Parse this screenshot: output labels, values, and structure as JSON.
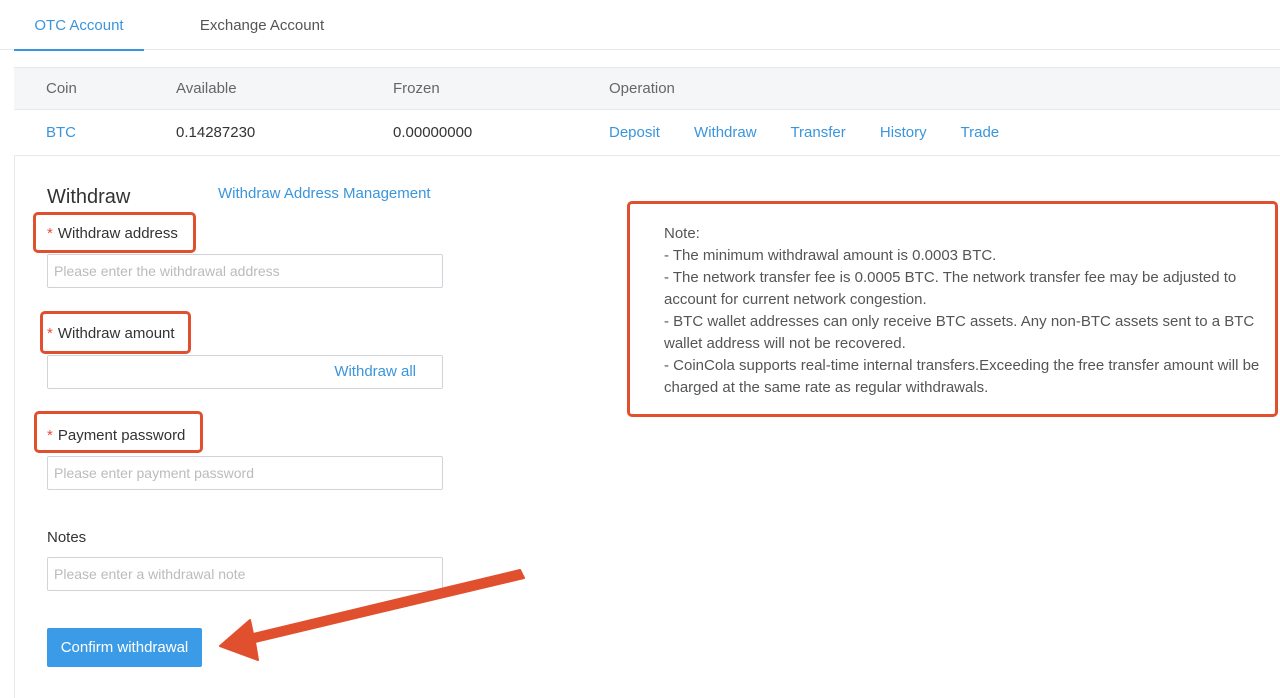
{
  "tabs": [
    {
      "label": "OTC Account",
      "active": true
    },
    {
      "label": "Exchange Account",
      "active": false
    }
  ],
  "table": {
    "headers": {
      "coin": "Coin",
      "available": "Available",
      "frozen": "Frozen",
      "operation": "Operation"
    },
    "row": {
      "coin": "BTC",
      "available": "0.14287230",
      "frozen": "0.00000000",
      "operations": [
        "Deposit",
        "Withdraw",
        "Transfer",
        "History",
        "Trade"
      ]
    }
  },
  "form": {
    "title": "Withdraw",
    "address_management": "Withdraw Address Management",
    "required_mark": "*",
    "address": {
      "label": "Withdraw address",
      "placeholder": "Please enter the withdrawal address"
    },
    "amount": {
      "label": "Withdraw amount",
      "withdraw_all": "Withdraw all"
    },
    "password": {
      "label": "Payment password",
      "placeholder": "Please enter payment password"
    },
    "notes": {
      "label": "Notes",
      "placeholder": "Please enter a withdrawal note"
    },
    "confirm_label": "Confirm withdrawal"
  },
  "note": {
    "heading": "Note:",
    "lines": [
      "- The minimum withdrawal amount is 0.0003 BTC.",
      "- The network transfer fee is 0.0005 BTC. The network transfer fee may be adjusted to account for current network congestion.",
      "- BTC wallet addresses can only receive BTC assets. Any non-BTC assets sent to a BTC wallet address will not be recovered.",
      "- CoinCola supports real-time internal transfers.Exceeding the free transfer amount will be charged at the same rate as regular withdrawals."
    ]
  },
  "colors": {
    "accent": "#3a95dc",
    "button": "#3c9be6",
    "highlight": "#e0502e",
    "required": "#e84b3a"
  }
}
